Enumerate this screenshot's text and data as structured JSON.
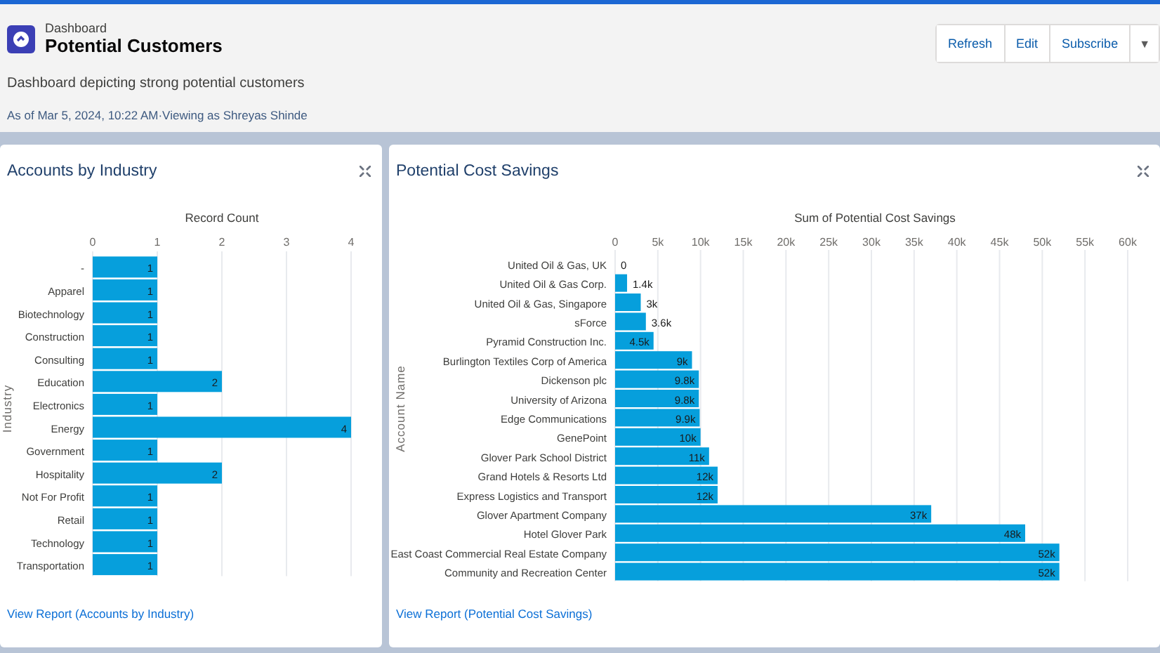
{
  "header": {
    "breadcrumb": "Dashboard",
    "title": "Potential Customers",
    "description": "Dashboard depicting strong potential customers",
    "timestamp": "As of Mar 5, 2024, 10:22 AM·Viewing as Shreyas Shinde"
  },
  "actions": {
    "buttons": [
      "Refresh",
      "Edit",
      "Subscribe"
    ],
    "menu": "▼"
  },
  "panels": [
    {
      "title": "Accounts by Industry",
      "link": "View Report (Accounts by Industry)",
      "chart_data": {
        "type": "bar",
        "orientation": "horizontal",
        "grid": true,
        "ylabel": "Industry",
        "categories": [
          "-",
          "Apparel",
          "Biotechnology",
          "Construction",
          "Consulting",
          "Education",
          "Electronics",
          "Energy",
          "Government",
          "Hospitality",
          "Not For Profit",
          "Retail",
          "Technology",
          "Transportation"
        ],
        "series": [
          {
            "name": "Record Count",
            "color": "#069fdc",
            "values": [
              1,
              1,
              1,
              1,
              1,
              2,
              1,
              4,
              1,
              2,
              1,
              1,
              1,
              1
            ]
          }
        ],
        "xlim": [
          0,
          4
        ],
        "xticks": [
          0,
          1,
          2,
          3,
          4
        ],
        "value_labels": [
          "1",
          "1",
          "1",
          "1",
          "1",
          "2",
          "1",
          "4",
          "1",
          "2",
          "1",
          "1",
          "1",
          "1"
        ]
      }
    },
    {
      "title": "Potential Cost Savings",
      "link": "View Report (Potential Cost Savings)",
      "chart_data": {
        "type": "bar",
        "orientation": "horizontal",
        "grid": true,
        "ylabel": "Account Name",
        "categories": [
          "United Oil & Gas, UK",
          "United Oil & Gas Corp.",
          "United Oil & Gas, Singapore",
          "sForce",
          "Pyramid Construction Inc.",
          "Burlington Textiles Corp of America",
          "Dickenson plc",
          "University of Arizona",
          "Edge Communications",
          "GenePoint",
          "Glover Park School District",
          "Grand Hotels & Resorts Ltd",
          "Express Logistics and Transport",
          "Glover Apartment Company",
          "Hotel Glover Park",
          "East Coast Commercial Real Estate Company",
          "Community and Recreation Center"
        ],
        "series": [
          {
            "name": "Sum of Potential Cost Savings",
            "color": "#069fdc",
            "values": [
              0,
              1400,
              3000,
              3600,
              4500,
              9000,
              9800,
              9800,
              9900,
              10000,
              11000,
              12000,
              12000,
              37000,
              48000,
              52000,
              52000
            ]
          }
        ],
        "xlim": [
          0,
          60000
        ],
        "xticks": [
          {
            "value": 0,
            "label": "0"
          },
          {
            "value": 5000,
            "label": "5k"
          },
          {
            "value": 10000,
            "label": "10k"
          },
          {
            "value": 15000,
            "label": "15k"
          },
          {
            "value": 20000,
            "label": "20k"
          },
          {
            "value": 25000,
            "label": "25k"
          },
          {
            "value": 30000,
            "label": "30k"
          },
          {
            "value": 35000,
            "label": "35k"
          },
          {
            "value": 40000,
            "label": "40k"
          },
          {
            "value": 45000,
            "label": "45k"
          },
          {
            "value": 50000,
            "label": "50k"
          },
          {
            "value": 55000,
            "label": "55k"
          },
          {
            "value": 60000,
            "label": "60k"
          }
        ],
        "value_labels": [
          "0",
          "1.4k",
          "3k",
          "3.6k",
          "4.5k",
          "9k",
          "9.8k",
          "9.8k",
          "9.9k",
          "10k",
          "11k",
          "12k",
          "12k",
          "37k",
          "48k",
          "52k",
          "52k"
        ]
      }
    }
  ]
}
